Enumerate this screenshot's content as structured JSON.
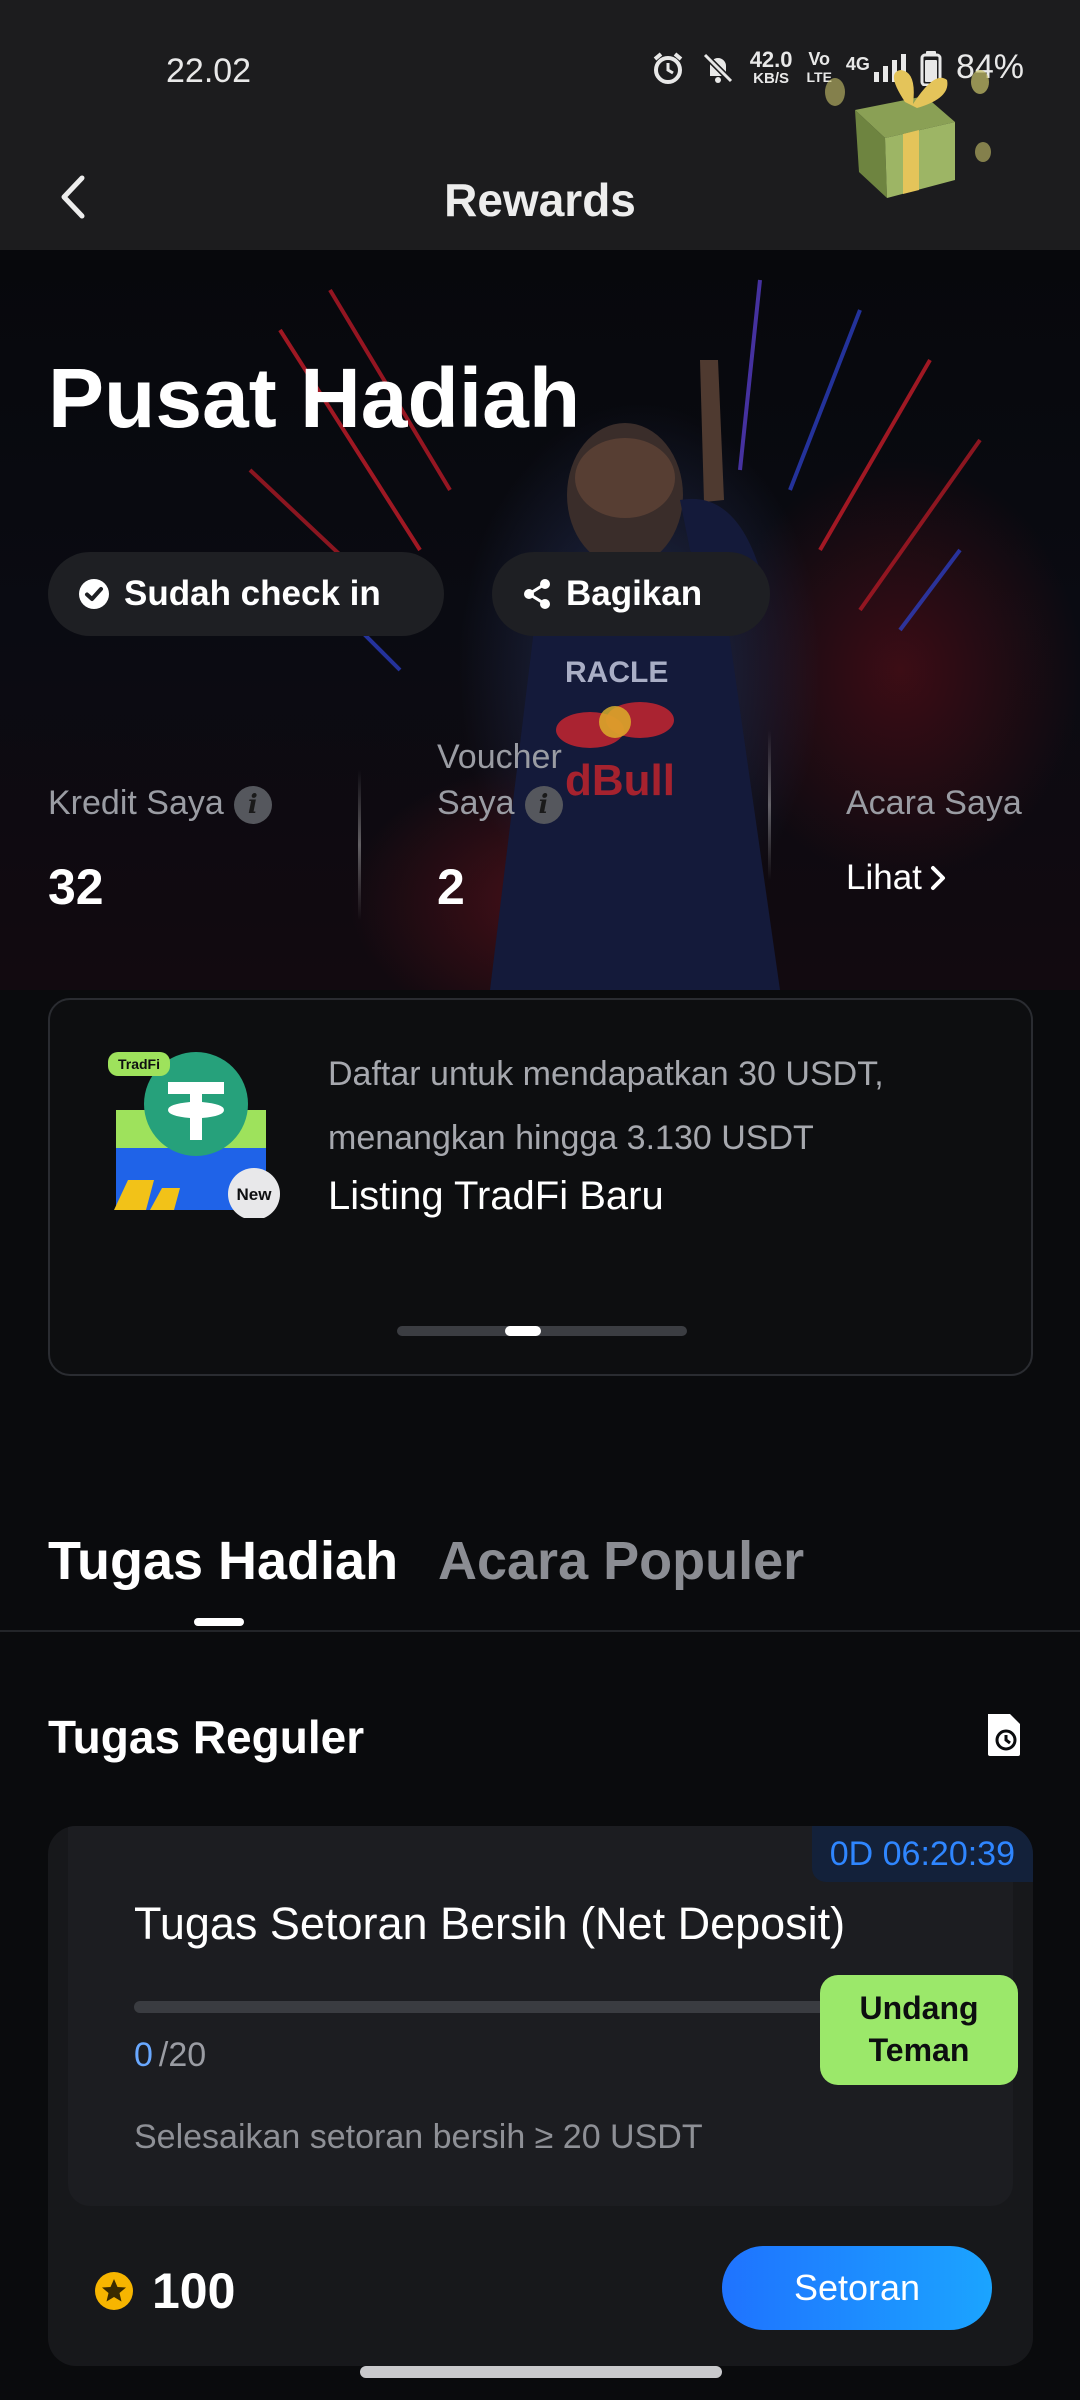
{
  "status_bar": {
    "time": "22.02",
    "net_speed_value": "42.0",
    "net_speed_unit": "KB/S",
    "volte_top": "Vo",
    "volte_bottom": "LTE",
    "network": "4G",
    "battery": "84%"
  },
  "header": {
    "title": "Rewards"
  },
  "hero": {
    "title": "Pusat Hadiah",
    "checkin_label": "Sudah check in",
    "share_label": "Bagikan",
    "stats": {
      "credit_label": "Kredit Saya",
      "credit_value": "32",
      "voucher_label_1": "Voucher",
      "voucher_label_2": "Saya",
      "voucher_value": "2",
      "events_label": "Acara Saya",
      "events_link": "Lihat"
    }
  },
  "promo": {
    "badge_tradfi": "TradFi",
    "badge_new": "New",
    "subtitle_line1": "Daftar untuk mendapatkan 30 USDT,",
    "subtitle_line2": "menangkan hingga 3.130 USDT",
    "title": "Listing TradFi Baru",
    "carousel_index": 2,
    "carousel_count": 3
  },
  "tabs": [
    {
      "label": "Tugas Hadiah",
      "active": true
    },
    {
      "label": "Acara Populer",
      "active": false
    }
  ],
  "tasks_section": {
    "title": "Tugas Reguler"
  },
  "task": {
    "countdown": "0D 06:20:39",
    "title": "Tugas Setoran Bersih (Net Deposit)",
    "progress_current": "0",
    "progress_total": "/20",
    "progress_fraction": 0,
    "description": "Selesaikan setoran bersih ≥ 20 USDT",
    "reward_points": "100",
    "action_label": "Setoran",
    "invite_line1": "Undang",
    "invite_line2": "Teman"
  },
  "colors": {
    "accent_blue": "#1f73ff",
    "invite_green": "#9be86a",
    "star_gold": "#f7b500"
  }
}
